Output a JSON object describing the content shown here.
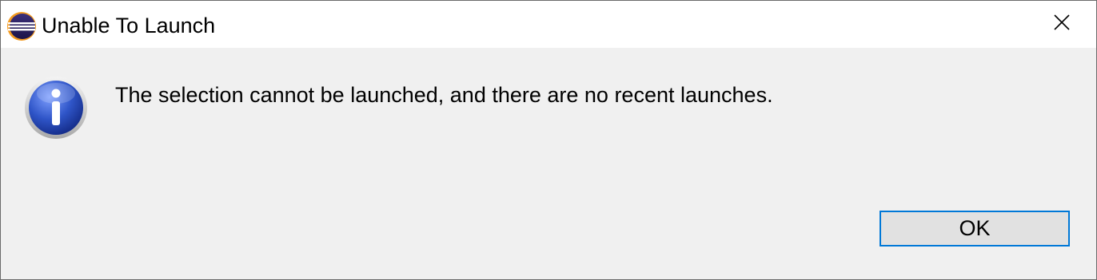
{
  "window": {
    "title": "Unable To Launch",
    "app_icon": "eclipse-icon",
    "close_icon": "close-icon"
  },
  "content": {
    "icon": "info-icon",
    "message": "The selection cannot be launched, and there are no recent launches."
  },
  "buttons": {
    "ok_label": "OK"
  },
  "colors": {
    "focus_border": "#0078d7",
    "dialog_background": "#f0f0f0",
    "titlebar_background": "#ffffff"
  }
}
